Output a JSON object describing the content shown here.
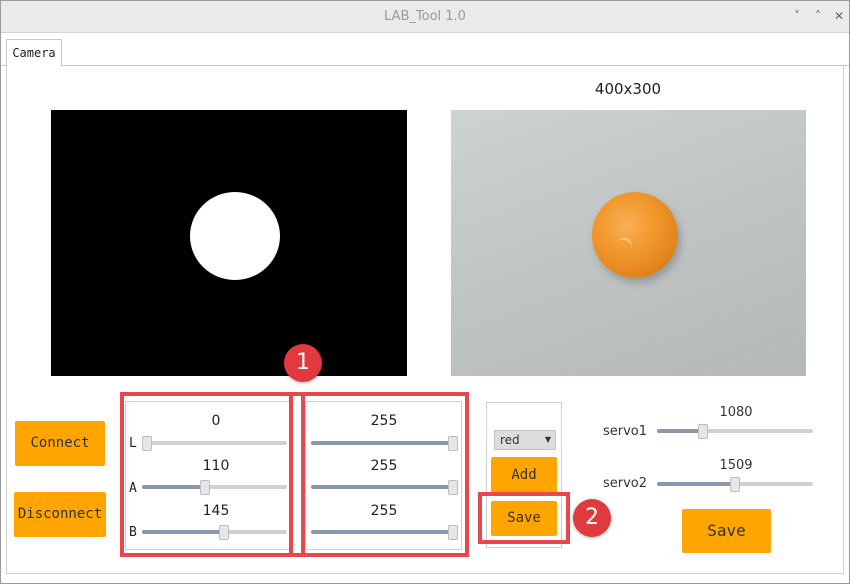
{
  "window": {
    "title": "LAB_Tool 1.0",
    "controls": {
      "minimize": "˅",
      "maximize": "˄",
      "close": "✕"
    }
  },
  "tabs": [
    {
      "label": "Camera"
    }
  ],
  "camera": {
    "resolution": "400x300"
  },
  "buttons": {
    "connect": "Connect",
    "disconnect": "Disconnect",
    "add": "Add",
    "save_color": "Save",
    "save_servo": "Save"
  },
  "lab": {
    "min": [
      {
        "axis": "L",
        "value": "0",
        "fraction": 0.0
      },
      {
        "axis": "A",
        "value": "110",
        "fraction": 0.431
      },
      {
        "axis": "B",
        "value": "145",
        "fraction": 0.569
      }
    ],
    "max": [
      {
        "value": "255",
        "fraction": 1.0
      },
      {
        "value": "255",
        "fraction": 1.0
      },
      {
        "value": "255",
        "fraction": 1.0
      }
    ]
  },
  "color_select": {
    "selected": "red"
  },
  "servos": [
    {
      "label": "servo1",
      "value": "1080",
      "fraction": 0.28
    },
    {
      "label": "servo2",
      "value": "1509",
      "fraction": 0.5
    }
  ],
  "annotations": [
    {
      "label": "1"
    },
    {
      "label": "2"
    }
  ],
  "colors": {
    "button": "#ffa500",
    "annotation": "#e0393e",
    "slider_fill": "#8a97a8"
  }
}
